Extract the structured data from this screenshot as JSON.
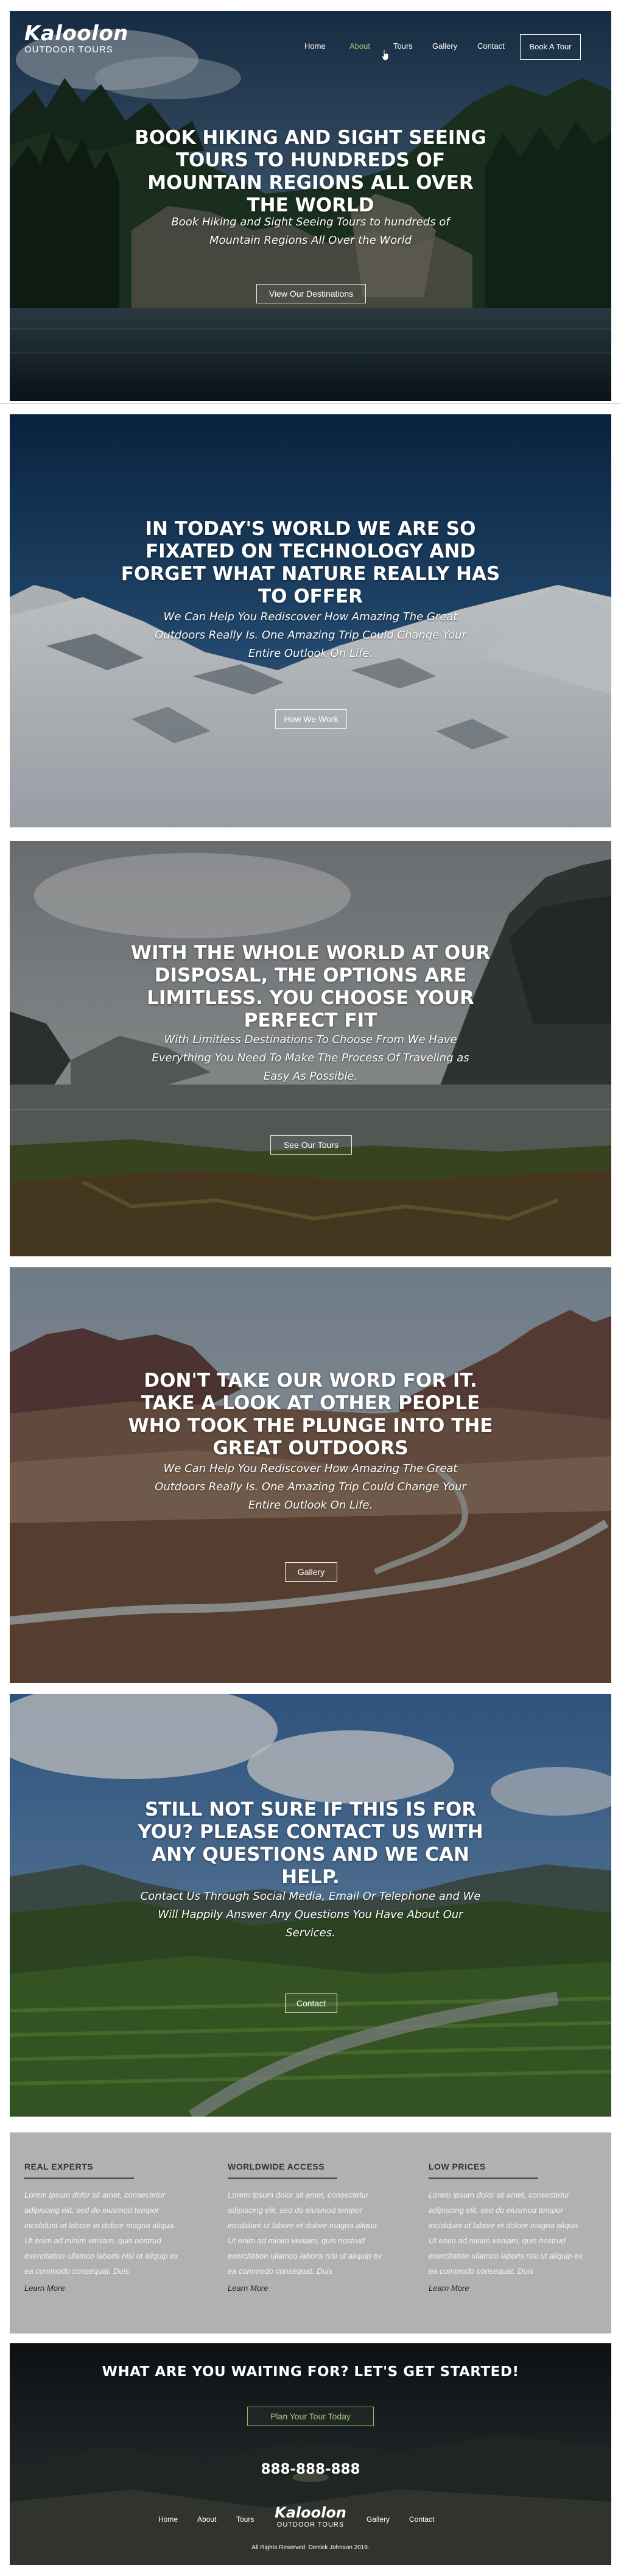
{
  "brand": {
    "name": "Kaloolon",
    "tagline": "OUTDOOR TOURS"
  },
  "nav": {
    "items": [
      "Home",
      "About",
      "Tours",
      "Gallery",
      "Contact"
    ],
    "active": "About",
    "cta": "Book A Tour"
  },
  "sections": [
    {
      "title": "BOOK HIKING AND SIGHT SEEING TOURS TO HUNDREDS OF MOUNTAIN REGIONS ALL OVER THE WORLD",
      "subtitle": "Book Hiking and Sight Seeing Tours to hundreds of Mountain Regions All Over the World",
      "button": "View Our Destinations"
    },
    {
      "title": "IN TODAY'S WORLD WE ARE SO FIXATED ON TECHNOLOGY AND FORGET WHAT NATURE REALLY HAS TO OFFER",
      "subtitle": "We Can Help You Rediscover How Amazing The Great Outdoors Really Is.  One Amazing Trip Could Change Your Entire Outlook On Life.",
      "button": "How We Work"
    },
    {
      "title": "WITH THE WHOLE WORLD AT OUR DISPOSAL, THE OPTIONS ARE LIMITLESS.  YOU CHOOSE YOUR PERFECT FIT",
      "subtitle": "With Limitless Destinations To Choose From We Have Everything You Need To Make The Process Of Traveling as Easy As Possible.",
      "button": "See Our Tours"
    },
    {
      "title": "DON'T TAKE OUR WORD FOR IT.  TAKE A LOOK AT OTHER PEOPLE WHO TOOK THE PLUNGE INTO THE GREAT OUTDOORS",
      "subtitle": "We Can Help You Rediscover How Amazing The Great Outdoors Really Is.  One Amazing Trip Could Change Your Entire Outlook On Life.",
      "button": "Gallery"
    },
    {
      "title": "STILL NOT SURE IF THIS IS FOR YOU? PLEASE CONTACT US WITH ANY QUESTIONS AND WE CAN HELP.",
      "subtitle": "Contact Us Through Social Media, Email Or Telephone and We Will Happily Answer Any Questions You Have About Our Services.",
      "button": "Contact"
    }
  ],
  "features": [
    {
      "title": "REAL EXPERTS",
      "text": "Lorem ipsum dolor sit amet, consectetur adipiscing elit, sed do eiusmod tempor incididunt ut labore et dolore magna aliqua. Ut enim ad minim veniam, quis nostrud exercitation ullamco laboris nisi ut aliquip ex ea commodo consequat. Duis",
      "link": "Learn More"
    },
    {
      "title": "WORLDWIDE ACCESS",
      "text": "Lorem ipsum dolor sit amet, consectetur adipiscing elit, sed do eiusmod tempor incididunt ut labore et dolore magna aliqua. Ut enim ad minim veniam, quis nostrud exercitation ullamco laboris nisi ut aliquip ex ea commodo consequat. Duis",
      "link": "Learn More"
    },
    {
      "title": "LOW PRICES",
      "text": "Lorem ipsum dolor sit amet, consectetur adipiscing elit, sed do eiusmod tempor incididunt ut labore et dolore magna aliqua. Ut enim ad minim veniam, quis nostrud exercitation ullamco laboris nisi ut aliquip ex ea commodo consequat. Duis",
      "link": "Learn More"
    }
  ],
  "footer": {
    "title": "WHAT ARE YOU WAITING FOR?  LET'S GET STARTED!",
    "button": "Plan Your Tour Today",
    "phone": "888-888-888",
    "nav_left": [
      "Home",
      "About",
      "Tours"
    ],
    "nav_right": [
      "Gallery",
      "Contact"
    ],
    "copyright": "All Rights Reserved.  Derrick Johnson 2018."
  },
  "colors": {
    "accent": "#8bc34a",
    "features_bg": "#b1b1b1"
  },
  "icons": [
    "pointer-cursor-icon"
  ]
}
